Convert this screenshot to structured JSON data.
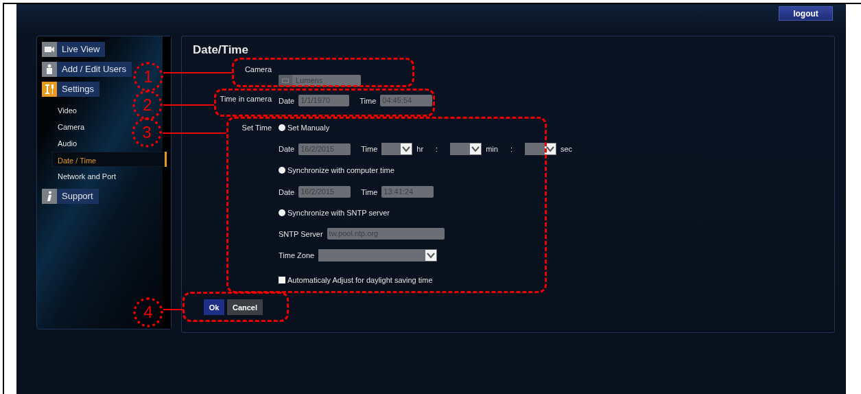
{
  "header": {
    "logout": "logout"
  },
  "sidebar": {
    "items": [
      {
        "label": "Live View",
        "selected": false
      },
      {
        "label": "Add / Edit Users",
        "selected": false
      },
      {
        "label": "Settings",
        "selected": true,
        "children": [
          {
            "label": "Video",
            "selected": false
          },
          {
            "label": "Camera",
            "selected": false
          },
          {
            "label": "Audio",
            "selected": false
          },
          {
            "label": "Date / Time",
            "selected": true
          },
          {
            "label": "Network and Port",
            "selected": false
          }
        ]
      },
      {
        "label": "Support",
        "selected": false
      }
    ]
  },
  "page": {
    "title": "Date/Time",
    "camera": {
      "label": "Camera",
      "value": "Lumens"
    },
    "time_in_camera": {
      "label": "Time in camera",
      "date_label": "Date",
      "date": "1/1/1970",
      "time_label": "Time",
      "time": "04:45:54"
    },
    "set_time": {
      "label": "Set Time",
      "manual": {
        "label": "Set Manualy",
        "selected": false,
        "date_label": "Date",
        "date": "16/2/2015",
        "time_label": "Time",
        "hr": "hr",
        "sep1": ":",
        "min": "min",
        "sep2": ":",
        "sec": "sec"
      },
      "computer": {
        "label": "Synchronize with computer time",
        "selected": false,
        "date_label": "Date",
        "date": "16/2/2015",
        "time_label": "Time",
        "time": "13:41:24"
      },
      "sntp": {
        "label": "Synchronize with SNTP server",
        "selected": false,
        "server_label": "SNTP Server",
        "server": "tw.pool.ntp.org",
        "zone_label": "Time Zone"
      },
      "dst": {
        "label": "Automaticaly Adjust for daylight saving time",
        "checked": false
      }
    },
    "buttons": [
      {
        "label": "Ok",
        "kind": "primary"
      },
      {
        "label": "Cancel",
        "kind": "secondary"
      }
    ]
  },
  "callouts": [
    "1",
    "2",
    "3",
    "4"
  ]
}
